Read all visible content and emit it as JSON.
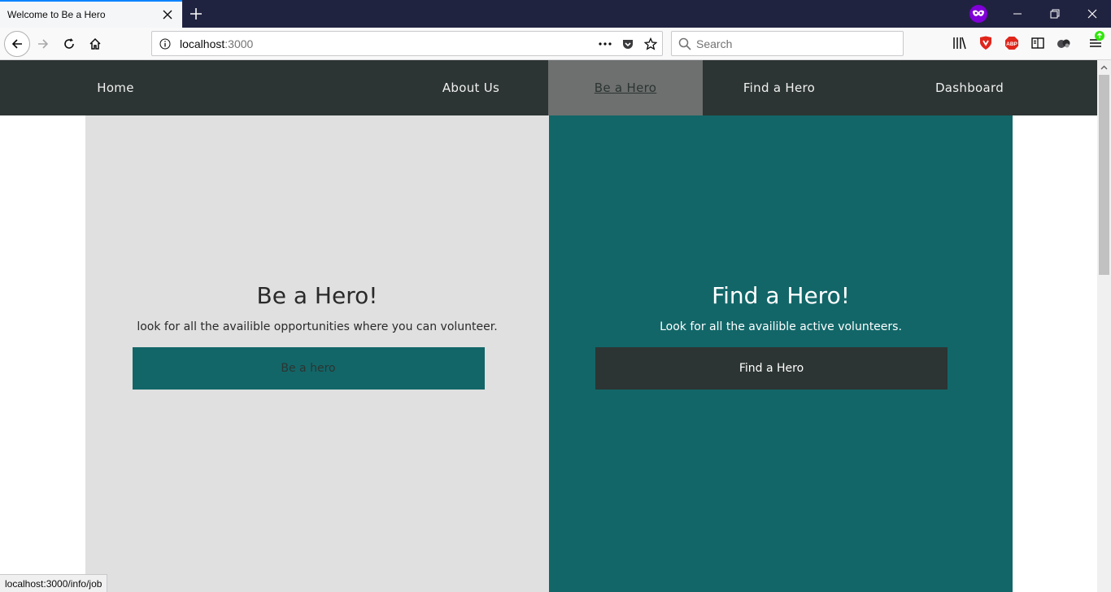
{
  "browser": {
    "tab_title": "Welcome to Be a Hero",
    "url_host": "localhost",
    "url_rest": ":3000",
    "search_placeholder": "Search",
    "status_text": "localhost:3000/info/job",
    "icons": [
      "back-icon",
      "forward-icon",
      "reload-icon",
      "home-icon",
      "info-icon",
      "page-actions-icon",
      "pocket-icon",
      "bookmark-star-icon",
      "search-icon",
      "library-icon",
      "shield-icon",
      "adblock-icon",
      "reader-view-icon",
      "extension-icon",
      "menu-icon",
      "private-browsing-icon"
    ]
  },
  "site_nav": {
    "items": [
      {
        "label": "Home"
      },
      {
        "label": "About Us"
      },
      {
        "label": "Be a Hero",
        "active": true
      },
      {
        "label": "Find a Hero"
      },
      {
        "label": "Dashboard"
      }
    ]
  },
  "panels": {
    "left": {
      "title": "Be a Hero!",
      "subtitle": "look for all the availible opportunities where you can volunteer.",
      "button": "Be a hero"
    },
    "right": {
      "title": "Find a Hero!",
      "subtitle": "Look for all the availible active volunteers.",
      "button": "Find a Hero"
    }
  },
  "colors": {
    "nav_bg": "#2c3533",
    "nav_active": "#6d706f",
    "teal": "#126668",
    "light_panel": "#e0e0e0"
  }
}
